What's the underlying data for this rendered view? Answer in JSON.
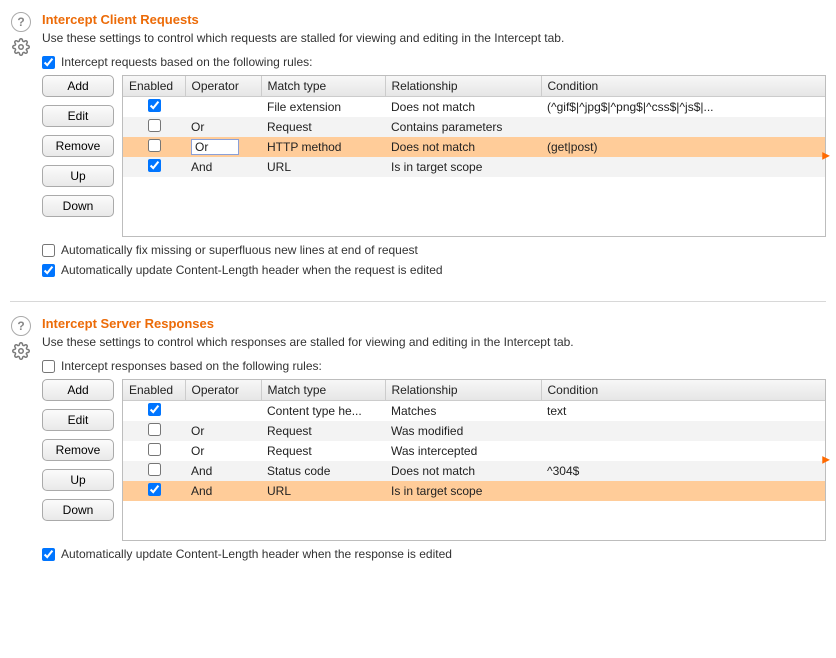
{
  "requests": {
    "title": "Intercept Client Requests",
    "desc": "Use these settings to control which requests are stalled for viewing and editing in the Intercept tab.",
    "ruleToggleLabel": "Intercept requests based on the following rules:",
    "ruleToggleChecked": true,
    "buttons": {
      "add": "Add",
      "edit": "Edit",
      "remove": "Remove",
      "up": "Up",
      "down": "Down"
    },
    "columns": {
      "enabled": "Enabled",
      "operator": "Operator",
      "match": "Match type",
      "rel": "Relationship",
      "cond": "Condition"
    },
    "rows": [
      {
        "enabled": true,
        "operator": "",
        "match": "File extension",
        "rel": "Does not match",
        "cond": "(^gif$|^jpg$|^png$|^css$|^js$|...",
        "selected": false
      },
      {
        "enabled": false,
        "operator": "Or",
        "match": "Request",
        "rel": "Contains parameters",
        "cond": "",
        "selected": false
      },
      {
        "enabled": false,
        "operator": "Or",
        "match": "HTTP method",
        "rel": "Does not match",
        "cond": "(get|post)",
        "selected": true,
        "editing": true
      },
      {
        "enabled": true,
        "operator": "And",
        "match": "URL",
        "rel": "Is in target scope",
        "cond": "",
        "selected": false
      }
    ],
    "opt1Label": "Automatically fix missing or superfluous new lines at end of request",
    "opt1Checked": false,
    "opt2Label": "Automatically update Content-Length header when the request is edited",
    "opt2Checked": true
  },
  "responses": {
    "title": "Intercept Server Responses",
    "desc": "Use these settings to control which responses are stalled for viewing and editing in the Intercept tab.",
    "ruleToggleLabel": "Intercept responses based on the following rules:",
    "ruleToggleChecked": false,
    "buttons": {
      "add": "Add",
      "edit": "Edit",
      "remove": "Remove",
      "up": "Up",
      "down": "Down"
    },
    "columns": {
      "enabled": "Enabled",
      "operator": "Operator",
      "match": "Match type",
      "rel": "Relationship",
      "cond": "Condition"
    },
    "rows": [
      {
        "enabled": true,
        "operator": "",
        "match": "Content type he...",
        "rel": "Matches",
        "cond": "text",
        "selected": false
      },
      {
        "enabled": false,
        "operator": "Or",
        "match": "Request",
        "rel": "Was modified",
        "cond": "",
        "selected": false
      },
      {
        "enabled": false,
        "operator": "Or",
        "match": "Request",
        "rel": "Was intercepted",
        "cond": "",
        "selected": false
      },
      {
        "enabled": false,
        "operator": "And",
        "match": "Status code",
        "rel": "Does not match",
        "cond": "^304$",
        "selected": false
      },
      {
        "enabled": true,
        "operator": "And",
        "match": "URL",
        "rel": "Is in target scope",
        "cond": "",
        "selected": true
      }
    ],
    "opt1Label": "Automatically update Content-Length header when the response is edited",
    "opt1Checked": true
  }
}
